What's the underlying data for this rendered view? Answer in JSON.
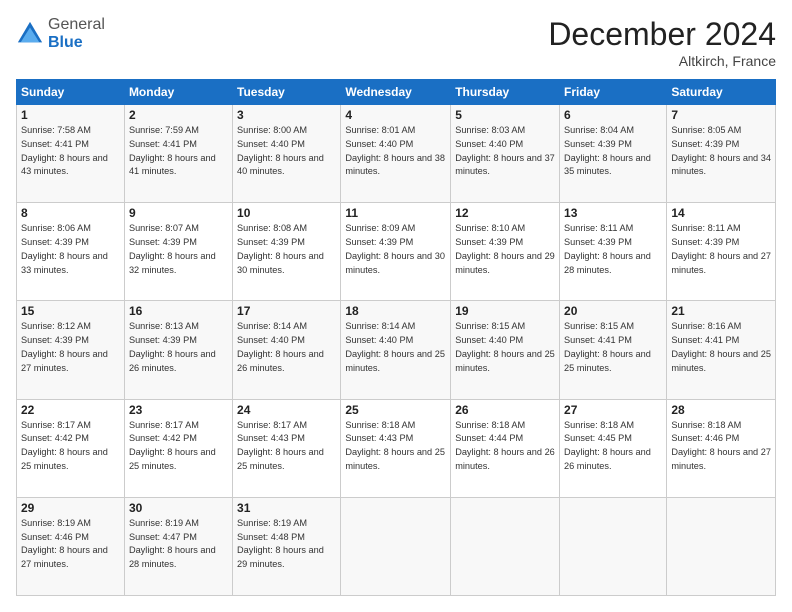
{
  "header": {
    "logo_general": "General",
    "logo_blue": "Blue",
    "month": "December 2024",
    "location": "Altkirch, France"
  },
  "weekdays": [
    "Sunday",
    "Monday",
    "Tuesday",
    "Wednesday",
    "Thursday",
    "Friday",
    "Saturday"
  ],
  "weeks": [
    [
      {
        "day": "1",
        "sunrise": "7:58 AM",
        "sunset": "4:41 PM",
        "daylight": "8 hours and 43 minutes."
      },
      {
        "day": "2",
        "sunrise": "7:59 AM",
        "sunset": "4:41 PM",
        "daylight": "8 hours and 41 minutes."
      },
      {
        "day": "3",
        "sunrise": "8:00 AM",
        "sunset": "4:40 PM",
        "daylight": "8 hours and 40 minutes."
      },
      {
        "day": "4",
        "sunrise": "8:01 AM",
        "sunset": "4:40 PM",
        "daylight": "8 hours and 38 minutes."
      },
      {
        "day": "5",
        "sunrise": "8:03 AM",
        "sunset": "4:40 PM",
        "daylight": "8 hours and 37 minutes."
      },
      {
        "day": "6",
        "sunrise": "8:04 AM",
        "sunset": "4:39 PM",
        "daylight": "8 hours and 35 minutes."
      },
      {
        "day": "7",
        "sunrise": "8:05 AM",
        "sunset": "4:39 PM",
        "daylight": "8 hours and 34 minutes."
      }
    ],
    [
      {
        "day": "8",
        "sunrise": "8:06 AM",
        "sunset": "4:39 PM",
        "daylight": "8 hours and 33 minutes."
      },
      {
        "day": "9",
        "sunrise": "8:07 AM",
        "sunset": "4:39 PM",
        "daylight": "8 hours and 32 minutes."
      },
      {
        "day": "10",
        "sunrise": "8:08 AM",
        "sunset": "4:39 PM",
        "daylight": "8 hours and 30 minutes."
      },
      {
        "day": "11",
        "sunrise": "8:09 AM",
        "sunset": "4:39 PM",
        "daylight": "8 hours and 30 minutes."
      },
      {
        "day": "12",
        "sunrise": "8:10 AM",
        "sunset": "4:39 PM",
        "daylight": "8 hours and 29 minutes."
      },
      {
        "day": "13",
        "sunrise": "8:11 AM",
        "sunset": "4:39 PM",
        "daylight": "8 hours and 28 minutes."
      },
      {
        "day": "14",
        "sunrise": "8:11 AM",
        "sunset": "4:39 PM",
        "daylight": "8 hours and 27 minutes."
      }
    ],
    [
      {
        "day": "15",
        "sunrise": "8:12 AM",
        "sunset": "4:39 PM",
        "daylight": "8 hours and 27 minutes."
      },
      {
        "day": "16",
        "sunrise": "8:13 AM",
        "sunset": "4:39 PM",
        "daylight": "8 hours and 26 minutes."
      },
      {
        "day": "17",
        "sunrise": "8:14 AM",
        "sunset": "4:40 PM",
        "daylight": "8 hours and 26 minutes."
      },
      {
        "day": "18",
        "sunrise": "8:14 AM",
        "sunset": "4:40 PM",
        "daylight": "8 hours and 25 minutes."
      },
      {
        "day": "19",
        "sunrise": "8:15 AM",
        "sunset": "4:40 PM",
        "daylight": "8 hours and 25 minutes."
      },
      {
        "day": "20",
        "sunrise": "8:15 AM",
        "sunset": "4:41 PM",
        "daylight": "8 hours and 25 minutes."
      },
      {
        "day": "21",
        "sunrise": "8:16 AM",
        "sunset": "4:41 PM",
        "daylight": "8 hours and 25 minutes."
      }
    ],
    [
      {
        "day": "22",
        "sunrise": "8:17 AM",
        "sunset": "4:42 PM",
        "daylight": "8 hours and 25 minutes."
      },
      {
        "day": "23",
        "sunrise": "8:17 AM",
        "sunset": "4:42 PM",
        "daylight": "8 hours and 25 minutes."
      },
      {
        "day": "24",
        "sunrise": "8:17 AM",
        "sunset": "4:43 PM",
        "daylight": "8 hours and 25 minutes."
      },
      {
        "day": "25",
        "sunrise": "8:18 AM",
        "sunset": "4:43 PM",
        "daylight": "8 hours and 25 minutes."
      },
      {
        "day": "26",
        "sunrise": "8:18 AM",
        "sunset": "4:44 PM",
        "daylight": "8 hours and 26 minutes."
      },
      {
        "day": "27",
        "sunrise": "8:18 AM",
        "sunset": "4:45 PM",
        "daylight": "8 hours and 26 minutes."
      },
      {
        "day": "28",
        "sunrise": "8:18 AM",
        "sunset": "4:46 PM",
        "daylight": "8 hours and 27 minutes."
      }
    ],
    [
      {
        "day": "29",
        "sunrise": "8:19 AM",
        "sunset": "4:46 PM",
        "daylight": "8 hours and 27 minutes."
      },
      {
        "day": "30",
        "sunrise": "8:19 AM",
        "sunset": "4:47 PM",
        "daylight": "8 hours and 28 minutes."
      },
      {
        "day": "31",
        "sunrise": "8:19 AM",
        "sunset": "4:48 PM",
        "daylight": "8 hours and 29 minutes."
      },
      null,
      null,
      null,
      null
    ]
  ]
}
